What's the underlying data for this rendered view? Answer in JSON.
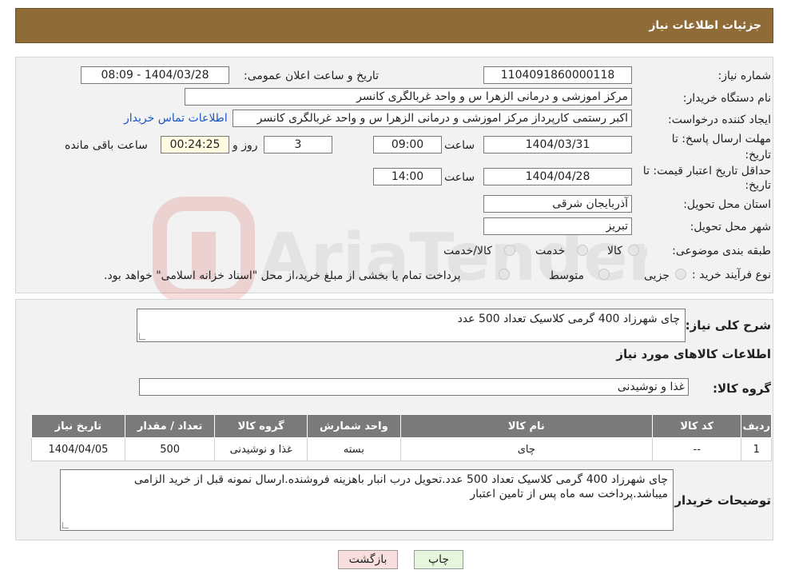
{
  "header": {
    "title": "جزئیات اطلاعات نیاز"
  },
  "form": {
    "need_number_label": "شماره نیاز:",
    "need_number": "1104091860000118",
    "announce_label": "تاریخ و ساعت اعلان عمومی:",
    "announce_value": "1404/03/28 - 08:09",
    "buyer_org_label": "نام دستگاه خریدار:",
    "buyer_org": "مرکز اموزشی و درمانی الزهرا س  و واحد غربالگری کانسر",
    "requester_label": "ایجاد کننده درخواست:",
    "requester": "اکبر رستمی کارپرداز مرکز اموزشی و درمانی الزهرا س  و واحد غربالگری کانسر",
    "contact_link": "اطلاعات تماس خریدار",
    "deadline_label": "مهلت ارسال پاسخ: تا تاریخ:",
    "deadline_date": "1404/03/31",
    "hour_label": "ساعت",
    "deadline_time": "09:00",
    "days": "3",
    "days_label": "روز و",
    "remaining_time": "00:24:25",
    "remaining_label": "ساعت باقی مانده",
    "validity_label": "حداقل تاریخ اعتبار قیمت: تا تاریخ:",
    "validity_date": "1404/04/28",
    "validity_time": "14:00",
    "province_label": "استان محل تحویل:",
    "province": "آذربایجان شرقی",
    "city_label": "شهر محل تحویل:",
    "city": "تبریز",
    "category_label": "طبقه بندی موضوعی:",
    "category_options": [
      "کالا",
      "خدمت",
      "کالا/خدمت"
    ],
    "process_label": "نوع فرآیند خرید :",
    "process_options": [
      "جزیی",
      "متوسط"
    ],
    "process_note": "پرداخت تمام یا بخشی از مبلغ خرید،از محل \"اسناد خزانه اسلامی\" خواهد بود."
  },
  "summary": {
    "desc_label": "شرح کلی نیاز:",
    "desc": "چای شهرزاد 400 گرمی کلاسیک تعداد 500 عدد",
    "goods_info_title": "اطلاعات کالاهای مورد نیاز",
    "group_label": "گروه کالا:",
    "group": "غذا و نوشیدنی"
  },
  "table": {
    "headers": [
      "ردیف",
      "کد کالا",
      "نام کالا",
      "واحد شمارش",
      "گروه کالا",
      "تعداد / مقدار",
      "تاریخ نیاز"
    ],
    "rows": [
      [
        "1",
        "--",
        "چای",
        "بسته",
        "غذا و نوشیدنی",
        "500",
        "1404/04/05"
      ]
    ]
  },
  "notes": {
    "label": "توضیحات خریدار:",
    "text": "چای شهرزاد 400 گرمی کلاسیک تعداد 500 عدد.تحویل درب انبار باهزینه فروشنده.ارسال نمونه قبل از خرید الزامی میباشد.پرداخت سه ماه پس از تامین اعتبار"
  },
  "buttons": {
    "print": "چاپ",
    "back": "بازگشت"
  },
  "watermark": {
    "text": "AriaTender.neT"
  },
  "colors": {
    "header_bg": "#8e6b37",
    "table_header_bg": "#7a7a7a",
    "back_btn_bg": "#f9dede",
    "print_btn_bg": "#e6f6dc"
  }
}
